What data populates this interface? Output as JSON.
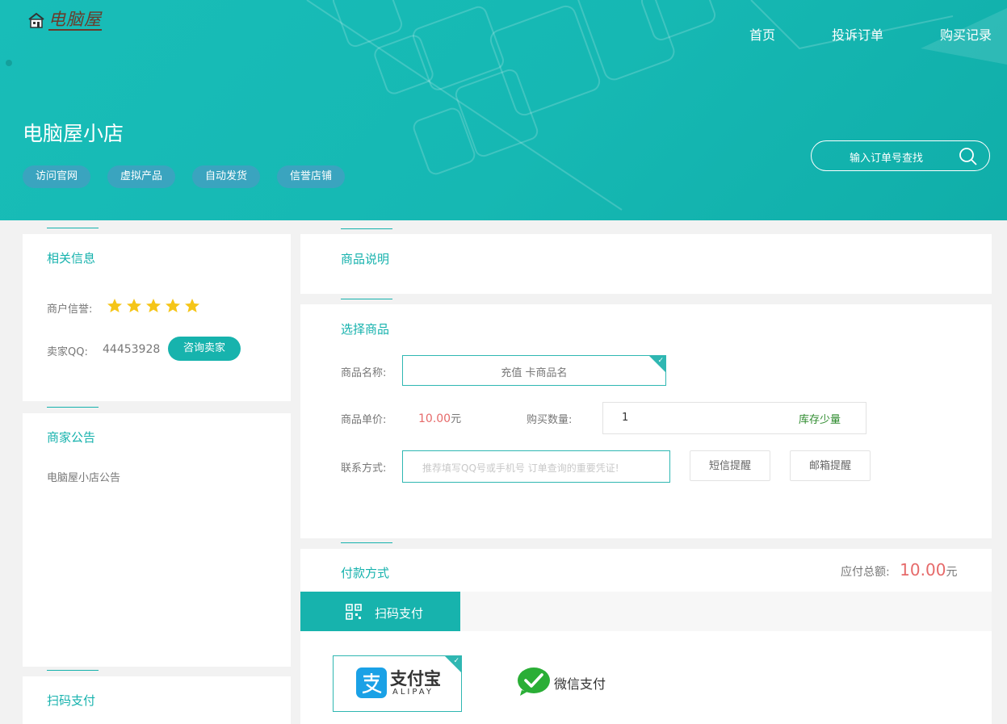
{
  "header": {
    "logo_text": "电脑屋",
    "nav": [
      "首页",
      "投诉订单",
      "购买记录"
    ],
    "shop_name": "电脑屋小店",
    "tags": [
      "访问官网",
      "虚拟产品",
      "自动发货",
      "信誉店铺"
    ],
    "search_placeholder": "输入订单号查找"
  },
  "info": {
    "title": "相关信息",
    "credit_label": "商户信誉:",
    "stars": 5,
    "qq_label": "卖家QQ:",
    "qq": "44453928",
    "consult_button": "咨询卖家"
  },
  "notice": {
    "title": "商家公告",
    "text": "电脑屋小店公告"
  },
  "left_pay": {
    "title": "扫码支付"
  },
  "desc": {
    "title": "商品说明"
  },
  "select": {
    "title": "选择商品",
    "name_label": "商品名称:",
    "name_value": "充值 卡商品名",
    "price_label": "商品单价:",
    "price_value": "10.00",
    "price_unit": "元",
    "qty_label": "购买数量:",
    "qty_value": "1",
    "stock": "库存少量",
    "contact_label": "联系方式:",
    "contact_placeholder": "推荐填写QQ号或手机号 订单查询的重要凭证!",
    "sms_button": "短信提醒",
    "email_button": "邮箱提醒"
  },
  "pay": {
    "title": "付款方式",
    "total_label": "应付总额:",
    "total_value": "10.00",
    "total_unit": "元",
    "tab_label": "扫码支付",
    "alipay_name": "支付宝",
    "alipay_sub": "ALIPAY",
    "wechat_label": "微信支付"
  },
  "colors": {
    "teal": "#17b3ad",
    "price_red": "#e66a6a",
    "stock_green": "#2e8b2e",
    "tag_blue": "#3aa4bf",
    "star": "#f5c518"
  },
  "icons": {
    "logo": "house-icon",
    "search": "search-icon",
    "star": "star-icon",
    "qr": "qr-code-icon",
    "wechat": "wechat-icon",
    "alipay": "alipay-icon",
    "check": "check-icon"
  }
}
